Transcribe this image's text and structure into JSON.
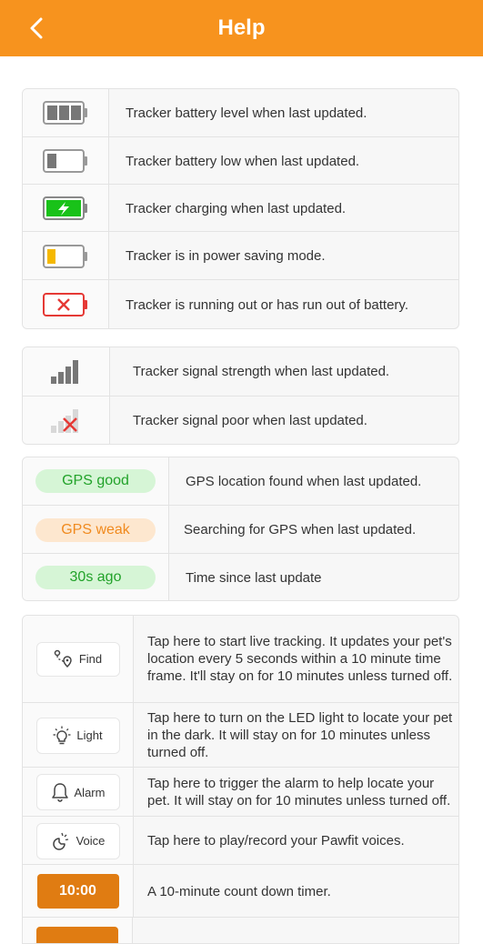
{
  "header": {
    "title": "Help"
  },
  "battery": [
    {
      "icon": "battery-full-icon",
      "text": "Tracker battery level when last updated."
    },
    {
      "icon": "battery-low-icon",
      "text": "Tracker battery low when last updated."
    },
    {
      "icon": "battery-charging-icon",
      "text": "Tracker charging when last updated."
    },
    {
      "icon": "battery-power-saving-icon",
      "text": "Tracker is in power saving mode."
    },
    {
      "icon": "battery-empty-icon",
      "text": "Tracker is running out or has run out of battery."
    }
  ],
  "signal": [
    {
      "icon": "signal-strength-icon",
      "text": "Tracker signal strength when last updated."
    },
    {
      "icon": "signal-poor-icon",
      "text": "Tracker signal poor when last updated."
    }
  ],
  "gps": [
    {
      "badge": "GPS good",
      "text": "GPS location found when last updated."
    },
    {
      "badge": "GPS weak",
      "text": "Searching for GPS when last updated."
    },
    {
      "badge": "30s ago",
      "text": "Time since last update"
    }
  ],
  "actions": [
    {
      "label": "Find",
      "icon": "find-route-icon",
      "text": "Tap here to start live tracking. It updates your pet's location every 5 seconds within a 10 minute time frame. It'll stay on for 10 minutes unless turned off."
    },
    {
      "label": "Light",
      "icon": "light-bulb-icon",
      "text": "Tap here to turn on the LED light to locate your pet in the dark. It will stay on for 10 minutes unless turned off."
    },
    {
      "label": "Alarm",
      "icon": "bell-icon",
      "text": "Tap here to trigger the alarm to help locate your pet. It will stay on for 10 minutes unless turned off."
    },
    {
      "label": "Voice",
      "icon": "voice-icon",
      "text": "Tap here to play/record your Pawfit voices."
    }
  ],
  "timer": {
    "label": "10:00",
    "text": "A 10-minute count down timer."
  },
  "colors": {
    "brand": "#f7931e",
    "gps_good": "#22a22a",
    "gps_weak": "#f08a1e",
    "danger": "#e53935",
    "charging": "#19c219",
    "saving": "#f5b800"
  }
}
